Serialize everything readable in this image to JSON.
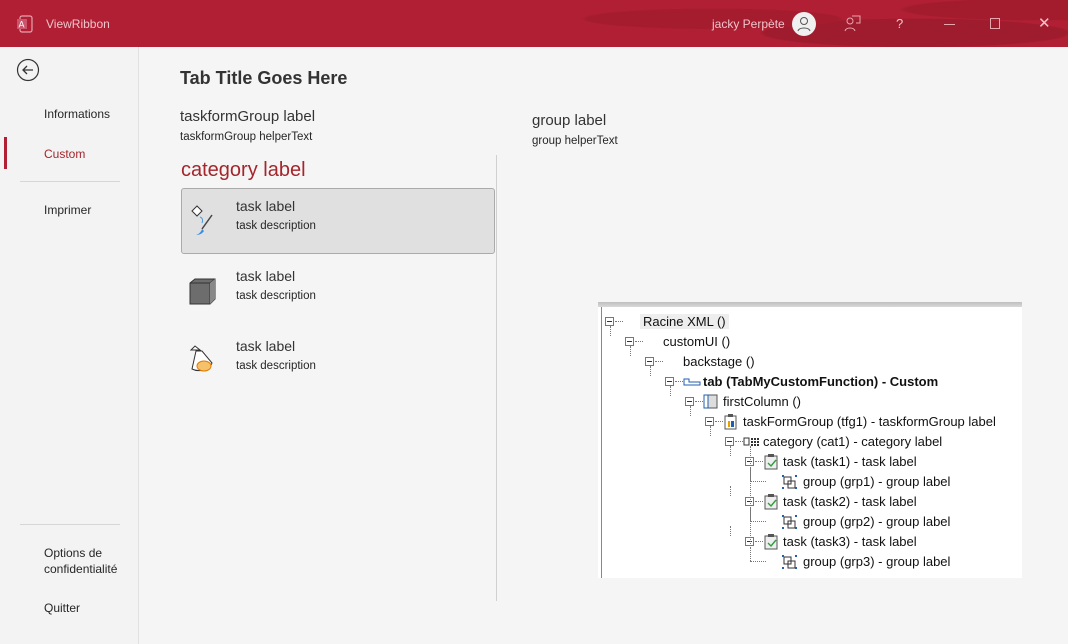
{
  "titlebar": {
    "app_title": "ViewRibbon",
    "user_name": "jacky Perpète"
  },
  "sidebar": {
    "items": [
      {
        "label": "Informations"
      },
      {
        "label": "Custom"
      },
      {
        "label": "Imprimer"
      },
      {
        "label": "Options de confidentialité"
      },
      {
        "label": "Quitter"
      }
    ]
  },
  "main": {
    "tab_title": "Tab Title Goes Here",
    "taskformgroup": {
      "label": "taskformGroup label",
      "helper": "taskformGroup helperText"
    },
    "category_label": "category label",
    "tasks": [
      {
        "label": "task label",
        "description": "task description"
      },
      {
        "label": "task label",
        "description": "task description"
      },
      {
        "label": "task label",
        "description": "task description"
      }
    ],
    "group": {
      "label": "group label",
      "helper": "group helperText"
    }
  },
  "tree": {
    "rows": [
      {
        "text": "Racine XML ()"
      },
      {
        "text": "customUI ()"
      },
      {
        "text": "backstage ()"
      },
      {
        "text": "tab (TabMyCustomFunction) - Custom"
      },
      {
        "text": "firstColumn ()"
      },
      {
        "text": "taskFormGroup (tfg1) - taskformGroup label"
      },
      {
        "text": "category (cat1) - category label"
      },
      {
        "text": "task (task1) - task label"
      },
      {
        "text": "group (grp1) - group label"
      },
      {
        "text": "task (task2) - task label"
      },
      {
        "text": "group (grp2) - group label"
      },
      {
        "text": "task (task3) - task label"
      },
      {
        "text": "group (grp3) - group label"
      }
    ]
  },
  "colors": {
    "accent": "#b01f33",
    "category": "#a4262c"
  }
}
